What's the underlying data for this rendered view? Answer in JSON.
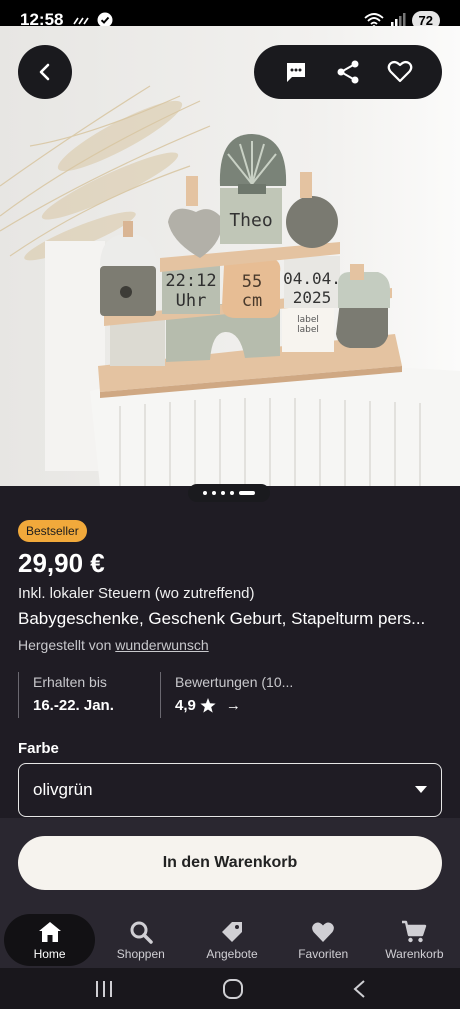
{
  "status_bar": {
    "time": "12:58",
    "battery": "72"
  },
  "product_image": {
    "block_texts": {
      "name": "Theo",
      "time_line1": "22:12",
      "time_line2": "Uhr",
      "size_line1": "55",
      "size_line2": "cm",
      "date_line1": "04.04.",
      "date_line2": "2025",
      "logo_line1": "label",
      "logo_line2": "label"
    },
    "carousel_dots": 5,
    "active_dot": 5
  },
  "product": {
    "badge": "Bestseller",
    "price": "29,90 €",
    "tax_note": "Inkl. lokaler Steuern (wo zutreffend)",
    "title": "Babygeschenke, Geschenk Geburt, Stapelturm pers...",
    "maker_prefix": "Hergestellt von",
    "maker_name": "wunderwunsch"
  },
  "stats": {
    "delivery_label": "Erhalten bis",
    "delivery_value": "16.-22. Jan.",
    "reviews_label": "Bewertungen (10...",
    "rating": "4,9",
    "rating_arrow": "→"
  },
  "color_select": {
    "label": "Farbe",
    "selected": "olivgrün"
  },
  "cart_button": "In den Warenkorb",
  "bottom_nav": [
    {
      "label": "Home",
      "icon": "home-icon",
      "active": true
    },
    {
      "label": "Shoppen",
      "icon": "search-icon",
      "active": false
    },
    {
      "label": "Angebote",
      "icon": "tag-icon",
      "active": false
    },
    {
      "label": "Favoriten",
      "icon": "heart-icon",
      "active": false
    },
    {
      "label": "Warenkorb",
      "icon": "cart-icon",
      "active": false
    }
  ],
  "colors": {
    "background": "#1f1c24",
    "badge": "#f1a93b",
    "cart_button": "#f6f3ee"
  }
}
